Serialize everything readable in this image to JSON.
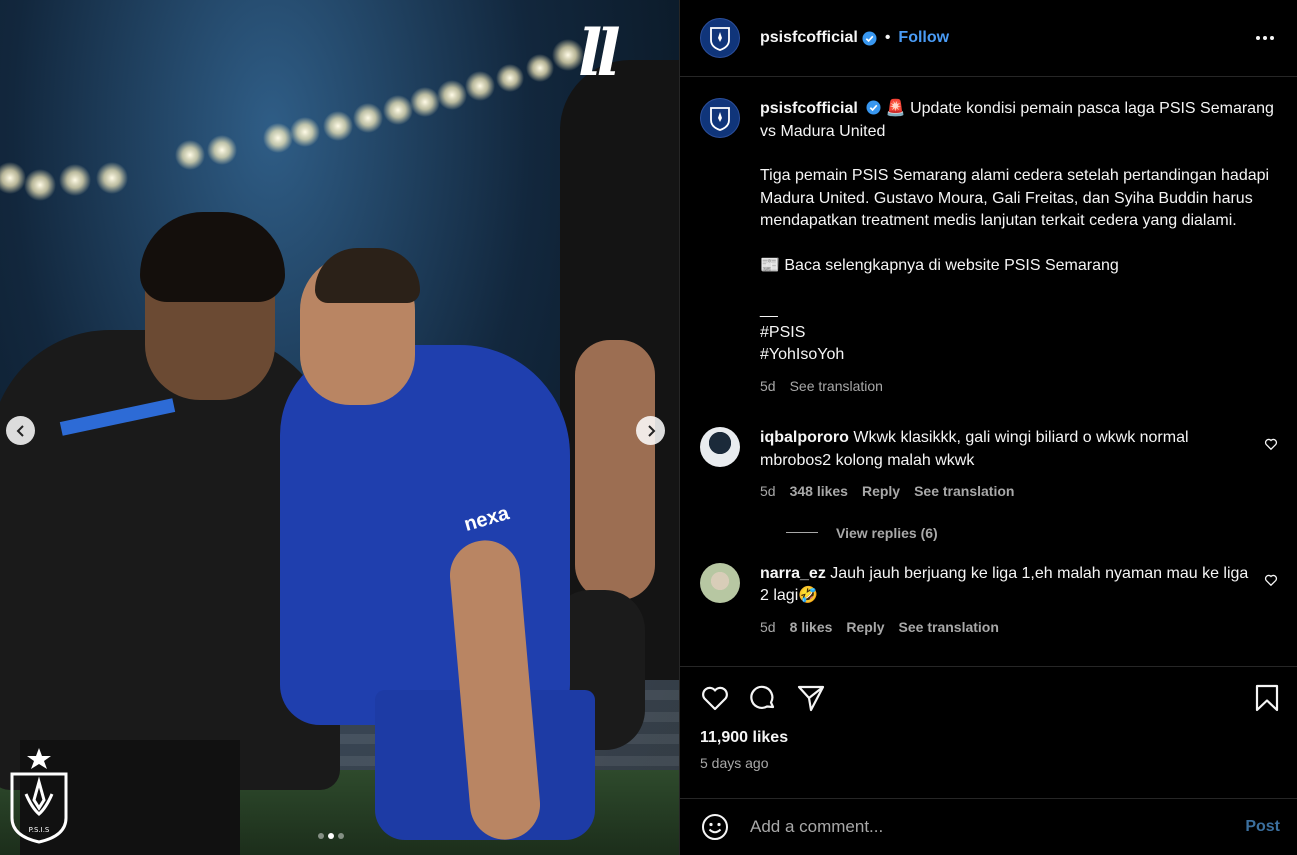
{
  "header": {
    "username": "psisfcofficial",
    "dot": "•",
    "follow_label": "Follow",
    "more_icon": "more-horizontal-icon"
  },
  "media": {
    "watermark": "ll",
    "sponsor_text": "nexa",
    "carousel_total": 3,
    "carousel_active": 2
  },
  "caption": {
    "username": "psisfcofficial",
    "emoji": "🚨",
    "line1": "Update kondisi pemain pasca laga PSIS Semarang vs Madura United",
    "paragraph": "Tiga pemain PSIS Semarang alami cedera setelah pertandingan hadapi Madura United. Gustavo Moura, Gali Freitas, dan Syiha Buddin harus mendapatkan treatment medis lanjutan terkait cedera yang dialami.",
    "read_more": "📰 Baca selengkapnya di website PSIS Semarang",
    "separator": "__",
    "tag1": "#PSIS",
    "tag2": "#YohIsoYoh",
    "time": "5d",
    "see_translation": "See translation"
  },
  "comments": [
    {
      "username": "iqbalpororo",
      "text": "Wkwk klasikkk, gali wingi biliard o wkwk normal mbrobos2 kolong malah wkwk",
      "time": "5d",
      "likes": "348 likes",
      "reply": "Reply",
      "see_translation": "See translation",
      "view_replies": "View replies (6)"
    },
    {
      "username": "narra_ez",
      "text": "Jauh jauh berjuang ke liga 1,eh malah nyaman mau ke liga 2 lagi🤣",
      "time": "5d",
      "likes": "8 likes",
      "reply": "Reply",
      "see_translation": "See translation"
    }
  ],
  "actions": {
    "likes": "11,900 likes",
    "ago": "5 days ago"
  },
  "add_comment": {
    "placeholder": "Add a comment...",
    "post_label": "Post"
  },
  "colors": {
    "accent": "#4a9cf6",
    "muted": "#a8a8a8",
    "background": "#000000",
    "jersey_blue": "#1f3fae"
  }
}
